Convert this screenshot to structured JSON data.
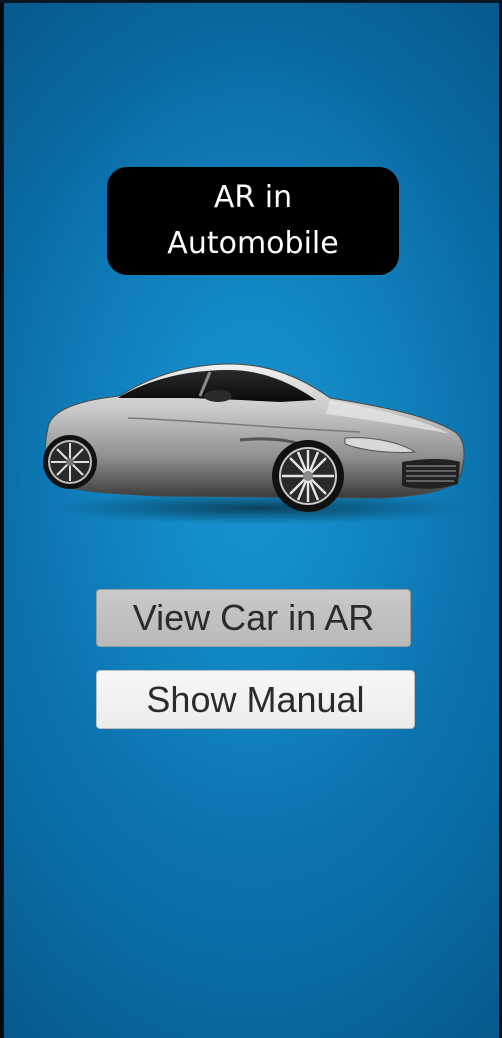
{
  "app": {
    "title": "AR in\nAutomobile"
  },
  "image": {
    "icon": "sports-car-image"
  },
  "buttons": {
    "view_ar_label": "View Car in AR",
    "manual_label": "Show Manual"
  },
  "colors": {
    "background": "#0a6ea8",
    "title_box": "#000000",
    "title_text": "#ffffff",
    "button_pressed": "#bebebe",
    "button_default": "#f2f2f2"
  }
}
